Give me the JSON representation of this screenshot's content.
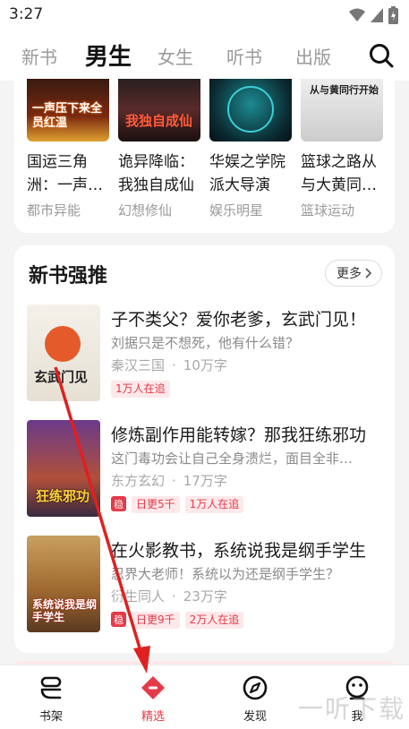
{
  "status": {
    "time": "3:27"
  },
  "tabs": [
    {
      "label": "新书"
    },
    {
      "label": "男生"
    },
    {
      "label": "女生"
    },
    {
      "label": "听书"
    },
    {
      "label": "出版"
    }
  ],
  "top_books": [
    {
      "title": "国运三角洲：一声…",
      "category": "都市异能",
      "cover_text": "一声压下来全员红温"
    },
    {
      "title": "诡异降临：我独自成仙",
      "category": "幻想修仙",
      "cover_text": "我独自成仙"
    },
    {
      "title": "华娱之学院派大导演",
      "category": "娱乐明星",
      "cover_text": ""
    },
    {
      "title": "篮球之路从与大黄同…",
      "category": "篮球运动",
      "cover_text": "从与黄同行开始"
    }
  ],
  "new_books": {
    "title": "新书强推",
    "more_label": "更多",
    "items": [
      {
        "title": "子不类父？爱你老爹，玄武门见！",
        "desc": "刘据只是不想死，他有什么错？",
        "genre": "秦汉三国",
        "words": "10万字",
        "stable": "",
        "tags": [
          "1万人在追"
        ],
        "cover_text": "玄武门见"
      },
      {
        "title": "修炼副作用能转嫁？那我狂练邪功",
        "desc": "这门毒功会让自己全身溃烂，面目全非…",
        "genre": "东方玄幻",
        "words": "17万字",
        "stable": "稳",
        "tags": [
          "日更5千",
          "1万人在追"
        ],
        "cover_text": "狂练邪功"
      },
      {
        "title": "在火影教书，系统说我是纲手学生",
        "desc": "忍界大老师！系统以为还是纲手学生？",
        "genre": "衍生同人",
        "words": "23万字",
        "stable": "稳",
        "tags": [
          "日更9千",
          "2万人在追"
        ],
        "cover_text": "系统说我是纲手学生"
      }
    ]
  },
  "bottom_nav": [
    {
      "label": "书架",
      "icon": "bookshelf-icon"
    },
    {
      "label": "精选",
      "icon": "featured-icon"
    },
    {
      "label": "发现",
      "icon": "compass-icon"
    },
    {
      "label": "我",
      "icon": "profile-icon"
    }
  ],
  "watermark": "一听下载",
  "colors": {
    "accent": "#e53a48",
    "tag_bg": "#fde8ea"
  }
}
